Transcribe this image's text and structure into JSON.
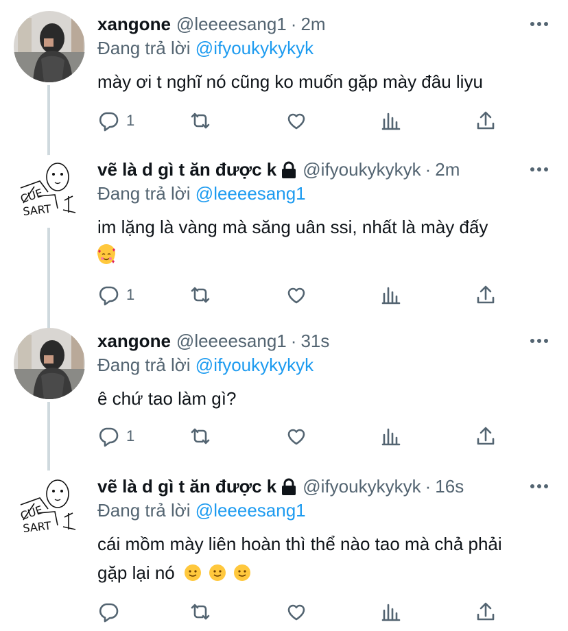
{
  "colors": {
    "text": "#0f1419",
    "secondary": "#536471",
    "accent": "#1d9bf0",
    "thread_line": "#cfd9de"
  },
  "labels": {
    "replying_to": "Đang trả lời",
    "separator": "·"
  },
  "tweets": [
    {
      "name": "xangone",
      "handle": "@leeeesang1",
      "time": "2m",
      "protected": false,
      "reply_to": "@ifyoukykykyk",
      "text": "mày ơi t nghĩ nó cũng ko muốn gặp mày đâu liyu",
      "emojis": [],
      "reply_count": "1",
      "avatar_icon": "photo-avatar"
    },
    {
      "name": "vẽ là d gì t ăn được k",
      "handle": "@ifyoukykykyk",
      "time": "2m",
      "protected": true,
      "reply_to": "@leeeesang1",
      "text": "im lặng là vàng mà săng uân ssi, nhất là mày đấy",
      "emojis": [
        "smiling-face-with-hearts"
      ],
      "reply_count": "1",
      "avatar_icon": "doodle-avatar"
    },
    {
      "name": "xangone",
      "handle": "@leeeesang1",
      "time": "31s",
      "protected": false,
      "reply_to": "@ifyoukykykyk",
      "text": "ê chứ tao làm gì?",
      "emojis": [],
      "reply_count": "1",
      "avatar_icon": "photo-avatar"
    },
    {
      "name": "vẽ là d gì t ăn được k",
      "handle": "@ifyoukykykyk",
      "time": "16s",
      "protected": true,
      "reply_to": "@leeeesang1",
      "text": "cái mồm mày liên hoàn thì thể nào tao mà chả phải gặp lại nó",
      "emojis": [
        "slightly-smiling-face",
        "slightly-smiling-face",
        "slightly-smiling-face"
      ],
      "reply_count": "",
      "avatar_icon": "doodle-avatar"
    }
  ]
}
